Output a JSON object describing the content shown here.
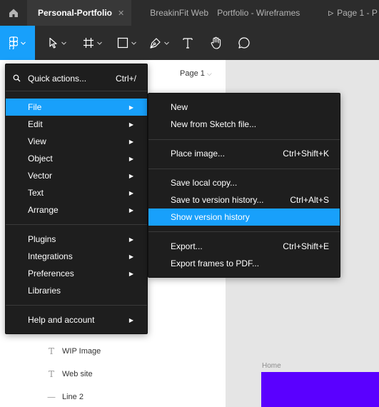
{
  "tabs": [
    {
      "label": "Personal-Portfolio",
      "active": true
    },
    {
      "label": "BreakinFit Web",
      "active": false
    },
    {
      "label": "Portfolio - Wireframes",
      "active": false
    },
    {
      "label": "Page 1 - P",
      "active": false
    }
  ],
  "page_selector": {
    "label": "Page 1"
  },
  "main_menu": {
    "quick_actions": {
      "label": "Quick actions...",
      "shortcut": "Ctrl+/"
    },
    "items": [
      "File",
      "Edit",
      "View",
      "Object",
      "Vector",
      "Text",
      "Arrange"
    ],
    "plugins_group": [
      "Plugins",
      "Integrations",
      "Preferences",
      "Libraries"
    ],
    "help": "Help and account"
  },
  "file_menu": {
    "new": "New",
    "new_sketch": "New from Sketch file...",
    "place_image": {
      "label": "Place image...",
      "shortcut": "Ctrl+Shift+K"
    },
    "save_local": "Save local copy...",
    "save_version": {
      "label": "Save to version history...",
      "shortcut": "Ctrl+Alt+S"
    },
    "show_version": "Show version history",
    "export": {
      "label": "Export...",
      "shortcut": "Ctrl+Shift+E"
    },
    "export_pdf": "Export frames to PDF..."
  },
  "layers": [
    {
      "label": "WIP Image",
      "icon": "text-icon"
    },
    {
      "label": "Web site",
      "icon": "text-icon"
    },
    {
      "label": "Line 2",
      "icon": "line-icon"
    }
  ],
  "canvas": {
    "frame_label": "Home",
    "frame_color": "#5a00ff"
  },
  "colors": {
    "accent": "#18a0fb",
    "menu_bg": "#1e1e1e",
    "toolbar_bg": "#2c2c2c"
  }
}
